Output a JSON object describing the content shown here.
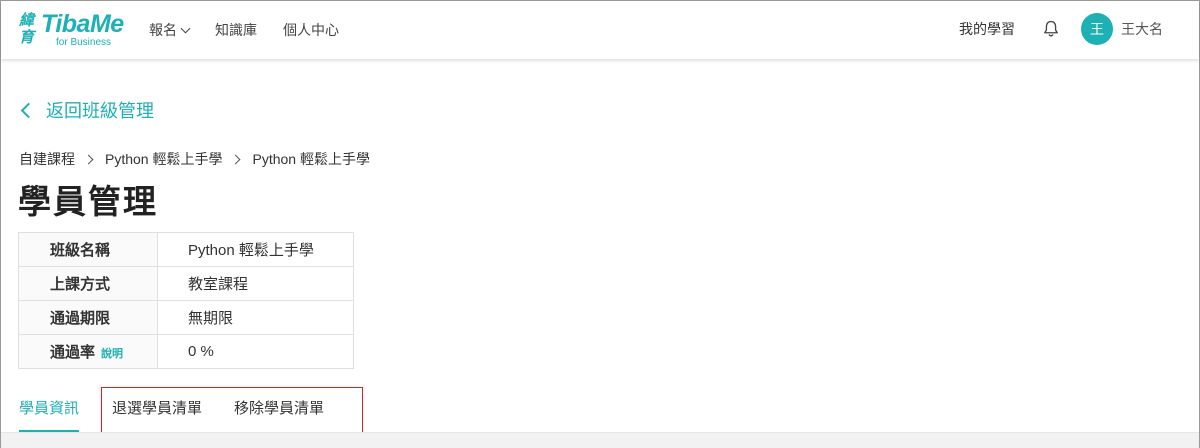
{
  "header": {
    "logo": {
      "cn_text": "緯育",
      "brand": "TibaMe",
      "sub": "for Business"
    },
    "nav": [
      {
        "label": "報名",
        "has_dropdown": true
      },
      {
        "label": "知識庫"
      },
      {
        "label": "個人中心"
      }
    ],
    "my_learning": "我的學習",
    "bell_icon": "bell-icon",
    "user": {
      "avatar_text": "王",
      "name": "王大名"
    }
  },
  "back_link": {
    "label": "返回班級管理",
    "icon": "chevron-left-icon"
  },
  "breadcrumb": [
    "自建課程",
    "Python 輕鬆上手學",
    "Python 輕鬆上手學"
  ],
  "page_title": "學員管理",
  "info_table": [
    {
      "key": "班級名稱",
      "value": "Python 輕鬆上手學"
    },
    {
      "key": "上課方式",
      "value": "教室課程"
    },
    {
      "key": "通過期限",
      "value": "無期限"
    },
    {
      "key": "通過率",
      "value": "0 %",
      "explain_label": "說明"
    }
  ],
  "tabs": [
    {
      "label": "學員資訊",
      "active": true
    },
    {
      "label": "退選學員清單",
      "active": false
    },
    {
      "label": "移除學員清單",
      "active": false
    }
  ],
  "colors": {
    "accent": "#1db0b5",
    "highlight_box": "#e02020"
  }
}
